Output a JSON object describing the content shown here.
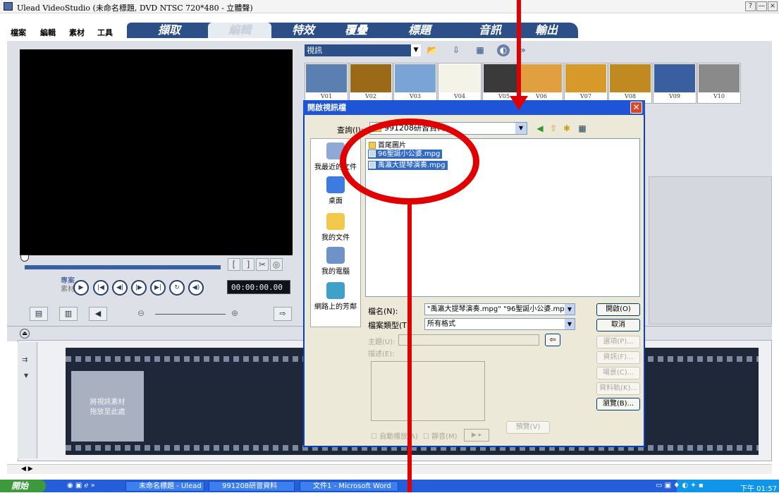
{
  "window": {
    "title": "Ulead VideoStudio (未命名標題, DVD NTSC 720*480 - 立體聲)",
    "controls": [
      "?",
      "—",
      "×"
    ]
  },
  "menu": [
    "檔案",
    "編輯",
    "素材",
    "工具"
  ],
  "steps": [
    {
      "label": "擷取",
      "active": false
    },
    {
      "label": "編輯",
      "active": true
    },
    {
      "label": "特效",
      "active": false
    },
    {
      "label": "覆疊",
      "active": false
    },
    {
      "label": "標題",
      "active": false
    },
    {
      "label": "音訊",
      "active": false
    },
    {
      "label": "輸出",
      "active": false
    }
  ],
  "player": {
    "project_label": "專案",
    "clip_label": "素材",
    "timecode": "00:00:00.00",
    "mark_buttons": [
      "[",
      "]",
      "✂",
      "◎"
    ],
    "controls": [
      "play",
      "home",
      "prev",
      "next",
      "end",
      "repeat",
      "volume"
    ]
  },
  "library": {
    "category": "視訊",
    "thumbnails": [
      {
        "label": "V01",
        "color": "#5a7fb0"
      },
      {
        "label": "V02",
        "color": "#9a6a18"
      },
      {
        "label": "V03",
        "color": "#7aa4d6"
      },
      {
        "label": "V04",
        "color": "#f3f3e8"
      },
      {
        "label": "V05",
        "color": "#3a3a3a"
      },
      {
        "label": "V06",
        "color": "#e0a040"
      },
      {
        "label": "V07",
        "color": "#d79a2a"
      },
      {
        "label": "V08",
        "color": "#c08a20"
      },
      {
        "label": "V09",
        "color": "#3a5fa0"
      },
      {
        "label": "V10",
        "color": "#8a8a8a"
      }
    ]
  },
  "timeline": {
    "drop_hint": "將視訊素材\n拖放至此處"
  },
  "dialog": {
    "title": "開啟視訊檔",
    "look_in_label": "查詢(I):",
    "look_in_value": "991208研習資料",
    "places": [
      "我最近的文件",
      "桌面",
      "我的文件",
      "我的電腦",
      "網路上的芳鄰"
    ],
    "files": [
      {
        "name": "首尾圖片",
        "type": "folder",
        "selected": false
      },
      {
        "name": "96聖誕小公婆.mpg",
        "type": "file",
        "selected": true
      },
      {
        "name": "禹瀛大提琴演奏.mpg",
        "type": "file",
        "selected": true
      }
    ],
    "filename_label": "檔名(N):",
    "filename_value": "\"禹瀛大提琴演奏.mpg\" \"96聖誕小公婆.mpg\"",
    "filetype_label": "檔案類型(T):",
    "filetype_value": "所有格式",
    "subject_label": "主題(U):",
    "desc_label": "描述(E):",
    "autoplay_label": "自動播放(A)",
    "mute_label": "靜音(M)",
    "preview_label": "預覽(V)",
    "buttons": {
      "open": "開啟(O)",
      "cancel": "取消",
      "options": "選項(P)...",
      "info": "資訊(F)...",
      "scene": "場景(C)...",
      "clip_info": "資料軌(K)...",
      "browse": "瀏覽(B)..."
    }
  },
  "taskbar": {
    "start": "開始",
    "tasks": [
      {
        "label": "未命名標題 - Ulead ..."
      },
      {
        "label": "991208研習資料"
      },
      {
        "label": "文件1 - Microsoft Word"
      }
    ],
    "clock": "下午 01:57"
  }
}
